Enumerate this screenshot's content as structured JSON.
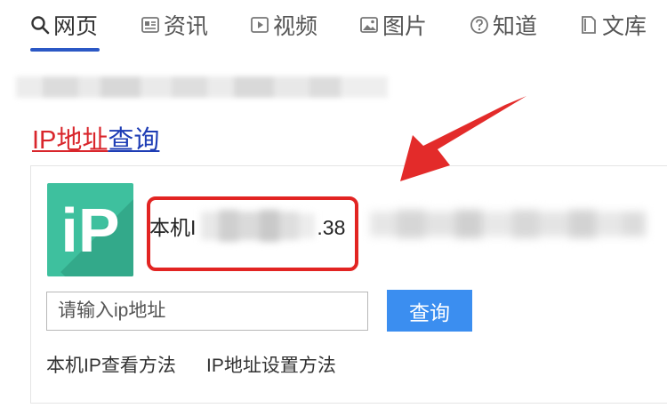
{
  "tabs": [
    {
      "label": "网页",
      "icon": "search-icon",
      "active": true
    },
    {
      "label": "资讯",
      "icon": "news-icon",
      "active": false
    },
    {
      "label": "视频",
      "icon": "video-icon",
      "active": false
    },
    {
      "label": "图片",
      "icon": "image-icon",
      "active": false
    },
    {
      "label": "知道",
      "icon": "question-icon",
      "active": false
    },
    {
      "label": "文库",
      "icon": "document-icon",
      "active": false
    }
  ],
  "result": {
    "title_part1": "IP地址",
    "title_part2": "查询",
    "logo_text": "iP",
    "ip_prefix": "本机I",
    "ip_suffix": ".38"
  },
  "search": {
    "placeholder": "请输入ip地址",
    "button_label": "查询"
  },
  "links": {
    "check_method": "本机IP查看方法",
    "setup_method": "IP地址设置方法"
  },
  "colors": {
    "accent_blue": "#2b58c5",
    "title_red": "#d9262c",
    "button_blue": "#3b8ef0",
    "logo_green": "#3ec09e",
    "highlight_red": "#e22422"
  }
}
